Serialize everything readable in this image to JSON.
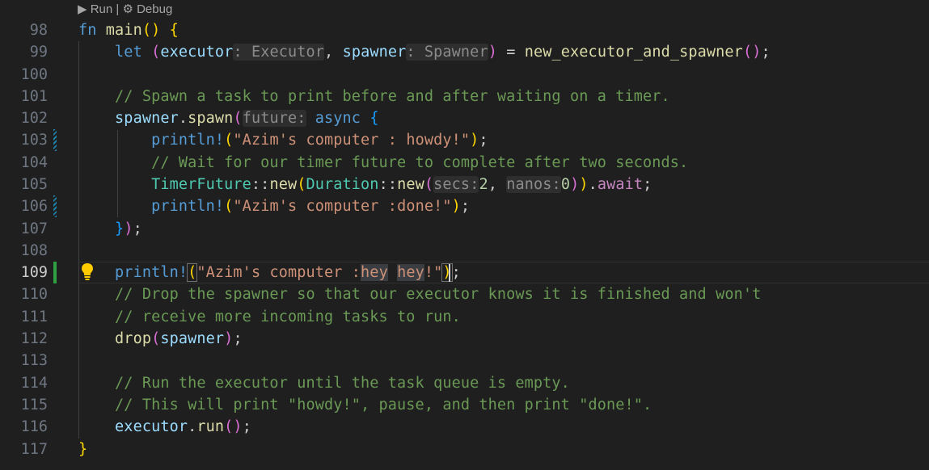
{
  "codelens": {
    "run": "▶ Run",
    "sep": " | ",
    "debug": "⚙ Debug"
  },
  "lines": [
    {
      "n": "98"
    },
    {
      "n": "99"
    },
    {
      "n": "100"
    },
    {
      "n": "101"
    },
    {
      "n": "102"
    },
    {
      "n": "103"
    },
    {
      "n": "104"
    },
    {
      "n": "105"
    },
    {
      "n": "106"
    },
    {
      "n": "107"
    },
    {
      "n": "108"
    },
    {
      "n": "109"
    },
    {
      "n": "110"
    },
    {
      "n": "111"
    },
    {
      "n": "112"
    },
    {
      "n": "113"
    },
    {
      "n": "114"
    },
    {
      "n": "115"
    },
    {
      "n": "116"
    },
    {
      "n": "117"
    }
  ],
  "code": {
    "l98": {
      "fn_kw": "fn",
      "name": "main",
      "open": "()",
      "brace": "{"
    },
    "l99": {
      "let": "let",
      "lp": "(",
      "v1": "executor",
      "h1": ": Executor",
      "comma": ", ",
      "v2": "spawner",
      "h2": ": Spawner",
      "rp": ")",
      "eq": " = ",
      "call": "new_executor_and_spawner",
      "pp": "()",
      "semi": ";"
    },
    "l101": "// Spawn a task to print before and after waiting on a timer.",
    "l102": {
      "obj": "spawner",
      "dot": ".",
      "m": "spawn",
      "lp": "(",
      "hint": "future:",
      "async": "async",
      "brace": "{"
    },
    "l103": {
      "mac": "println!",
      "lp": "(",
      "s": "\"Azim's computer : howdy!\"",
      "rp": ")",
      "semi": ";"
    },
    "l104": "// Wait for our timer future to complete after two seconds.",
    "l105": {
      "t1": "TimerFuture",
      "c1": "::",
      "f1": "new",
      "lp1": "(",
      "t2": "Duration",
      "c2": "::",
      "f2": "new",
      "lp2": "(",
      "h1": "secs:",
      "n1": "2",
      "comma": ", ",
      "h2": "nanos:",
      "n2": "0",
      "rp2": ")",
      "rp1": ")",
      "dot": ".",
      "aw": "await",
      "semi": ";"
    },
    "l106": {
      "mac": "println!",
      "lp": "(",
      "s": "\"Azim's computer :done!\"",
      "rp": ")",
      "semi": ";"
    },
    "l107": {
      "rb": "}",
      "rp": ")",
      "semi": ";"
    },
    "l109": {
      "mac": "println!",
      "lp": "(",
      "s1": "\"Azim's computer :",
      "s2": "hey",
      "s3": " ",
      "s4": "hey",
      "s5": "!\"",
      "rp": ")",
      "semi": ";"
    },
    "l110": "// Drop the spawner so that our executor knows it is finished and won't",
    "l111": "// receive more incoming tasks to run.",
    "l112": {
      "f": "drop",
      "lp": "(",
      "v": "spawner",
      "rp": ")",
      "semi": ";"
    },
    "l114": "// Run the executor until the task queue is empty.",
    "l115": "// This will print \"howdy!\", pause, and then print \"done!\".",
    "l116": {
      "obj": "executor",
      "dot": ".",
      "m": "run",
      "pp": "()",
      "semi": ";"
    },
    "l117": {
      "rb": "}"
    }
  }
}
